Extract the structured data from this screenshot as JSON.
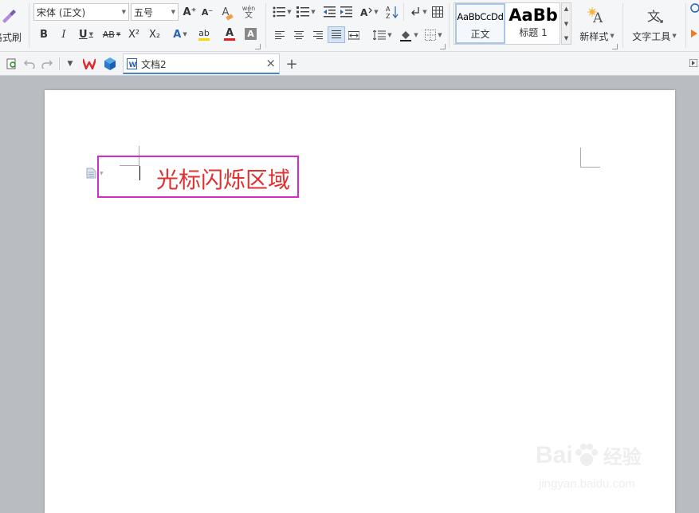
{
  "ribbon": {
    "format_painter_label": "格式刷",
    "font_name": "宋体 (正文)",
    "font_size": "五号",
    "grow_font": "A⁺",
    "shrink_font": "A⁻",
    "clear_format": "A",
    "phonetic_top": "wén",
    "phonetic_bottom": "文",
    "bold": "B",
    "italic": "I",
    "underline": "U",
    "strike": "AB",
    "superscript": "X²",
    "subscript": "X₂",
    "text_effect": "A",
    "highlight": "ab",
    "font_color": "A",
    "char_shading": "A",
    "styles": [
      {
        "preview": "AaBbCcDd",
        "label": "正文"
      },
      {
        "preview": "AaBb",
        "label": "标题 1"
      }
    ],
    "new_style_label": "新样式",
    "text_tools_label": "文字工具"
  },
  "tabs": {
    "doc_title": "文档2",
    "close_glyph": "×",
    "add_glyph": "+"
  },
  "document": {
    "annotation": "光标闪烁区域"
  },
  "watermark": {
    "brand_left": "Bai",
    "brand_right": "经验",
    "url": "jingyan.baidu.com"
  },
  "colors": {
    "highlight_border": "#d629c8",
    "annotation_text": "#e03030",
    "tab_accent": "#4a86c5",
    "font_color_bar": "#e02020",
    "highlight_bar": "#f5d800"
  }
}
